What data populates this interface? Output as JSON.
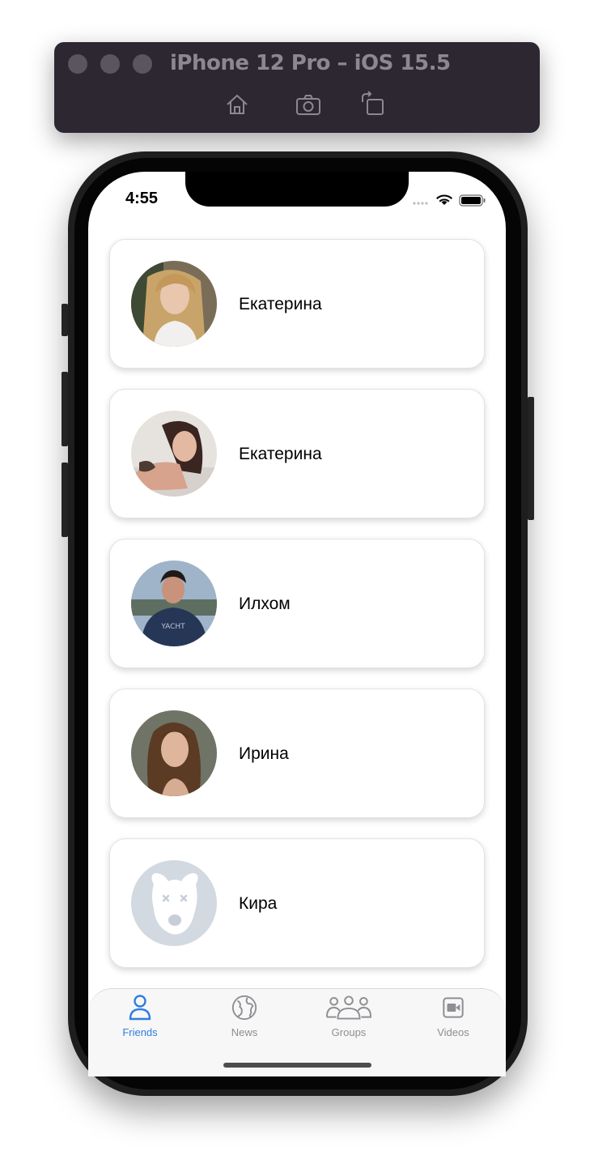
{
  "simulator": {
    "title": "iPhone 12 Pro – iOS 15.5",
    "buttons": [
      "home-icon",
      "screenshot-icon",
      "rotate-icon"
    ]
  },
  "status_bar": {
    "time": "4:55",
    "icons": [
      "signal-dots-icon",
      "wifi-icon",
      "battery-icon"
    ]
  },
  "friends": [
    {
      "name": "Екатерина",
      "avatar": "photo-blonde-woman"
    },
    {
      "name": "Екатерина",
      "avatar": "photo-brunette-woman"
    },
    {
      "name": "Илхом",
      "avatar": "photo-man-navy-shirt"
    },
    {
      "name": "Ирина",
      "avatar": "photo-woman-long-hair"
    },
    {
      "name": "Кира",
      "avatar": "default-dog-placeholder-icon"
    }
  ],
  "tabbar": {
    "tabs": [
      {
        "label": "Friends",
        "icon": "person-icon",
        "active": true
      },
      {
        "label": "News",
        "icon": "globe-icon",
        "active": false
      },
      {
        "label": "Groups",
        "icon": "group-icon",
        "active": false
      },
      {
        "label": "Videos",
        "icon": "video-icon",
        "active": false
      }
    ]
  },
  "colors": {
    "accent": "#2f7ee0",
    "inactive": "#8e8e93",
    "sim_bar": "#2c2731"
  }
}
